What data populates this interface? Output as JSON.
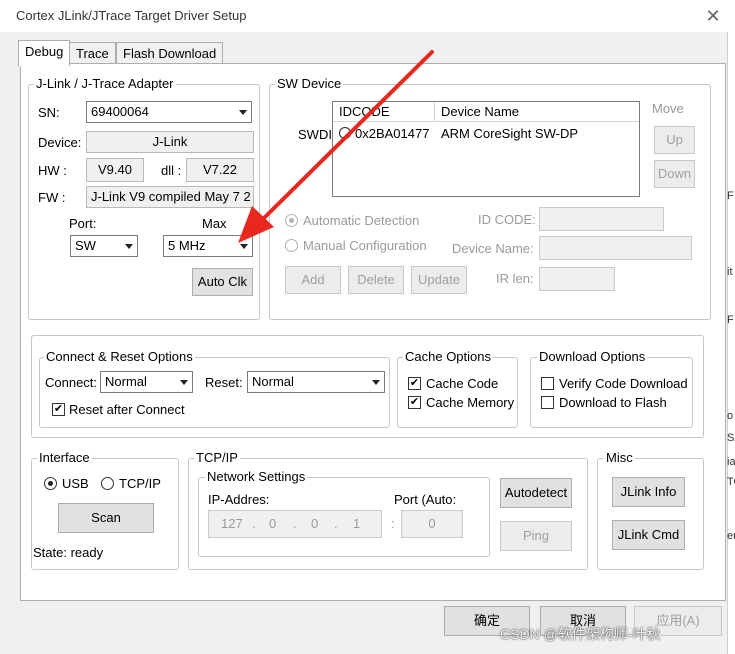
{
  "window": {
    "title": "Cortex JLink/JTrace Target Driver Setup",
    "close_glyph": "✕"
  },
  "tabs": [
    {
      "label": "Debug"
    },
    {
      "label": "Trace"
    },
    {
      "label": "Flash Download"
    }
  ],
  "adapter": {
    "group_label": "J-Link / J-Trace Adapter",
    "sn_label": "SN:",
    "sn_value": "69400064",
    "device_label": "Device:",
    "device_value": "J-Link",
    "hw_label": "HW :",
    "hw_value": "V9.40",
    "dll_label": "dll :",
    "dll_value": "V7.22",
    "fw_label": "FW :",
    "fw_value": "J-Link V9 compiled May  7 2",
    "port_label": "Port:",
    "port_value": "SW",
    "max_label": "Max",
    "max_value": "5 MHz",
    "auto_clk": "Auto Clk"
  },
  "sw_device": {
    "group_label": "SW Device",
    "swdi_label": "SWDI",
    "columns": [
      "IDCODE",
      "Device Name"
    ],
    "rows": [
      {
        "idcode": "0x2BA01477",
        "name": "ARM CoreSight SW-DP"
      }
    ],
    "move_label": "Move",
    "up": "Up",
    "down": "Down",
    "auto_detection": "Automatic Detection",
    "manual_config": "Manual Configuration",
    "id_code_label": "ID CODE:",
    "device_name_label": "Device Name:",
    "ir_len_label": "IR len:",
    "add": "Add",
    "delete": "Delete",
    "update": "Update"
  },
  "connect_reset": {
    "group_label": "Connect & Reset Options",
    "connect_label": "Connect:",
    "connect_value": "Normal",
    "reset_label": "Reset:",
    "reset_value": "Normal",
    "reset_after_connect": "Reset after Connect",
    "reset_after_connect_checked": true
  },
  "cache": {
    "group_label": "Cache Options",
    "cache_code": "Cache Code",
    "cache_code_checked": true,
    "cache_memory": "Cache Memory",
    "cache_memory_checked": true
  },
  "download": {
    "group_label": "Download Options",
    "verify": "Verify Code Download",
    "verify_checked": false,
    "to_flash": "Download to Flash",
    "to_flash_checked": false
  },
  "interface": {
    "group_label": "Interface",
    "usb": "USB",
    "tcpip": "TCP/IP",
    "selected": "USB",
    "scan": "Scan",
    "state": "State: ready"
  },
  "tcpip": {
    "group_label": "TCP/IP",
    "network_label": "Network Settings",
    "ip_label": "IP-Addres:",
    "ip_octets": [
      "127",
      "0",
      "0",
      "1"
    ],
    "port_label": "Port (Auto:",
    "port_colon": ":",
    "port_value": "0",
    "autodetect": "Autodetect",
    "ping": "Ping"
  },
  "misc": {
    "group_label": "Misc",
    "jlink_info": "JLink Info",
    "jlink_cmd": "JLink Cmd"
  },
  "footer": {
    "ok": "确定",
    "cancel": "取消",
    "apply": "应用(A)"
  },
  "right_strip": [
    "F",
    "it",
    "F",
    "o",
    "SA",
    "ia",
    "TO",
    "er"
  ],
  "watermark": "CSDN @软件架构师-叶秋",
  "colors": {
    "annotation_arrow": "#e8271f",
    "window_bg": "#f0f0f0",
    "panel_bg": "#ffffff"
  }
}
